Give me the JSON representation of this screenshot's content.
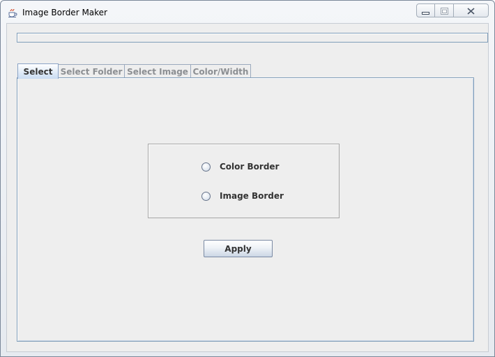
{
  "window": {
    "title": "Image Border Maker"
  },
  "tabs": [
    {
      "label": "Select",
      "selected": true
    },
    {
      "label": "Select Folder",
      "selected": false
    },
    {
      "label": "Select Image",
      "selected": false
    },
    {
      "label": "Color/Width",
      "selected": false
    }
  ],
  "border_options": [
    {
      "label": "Color Border",
      "checked": false
    },
    {
      "label": "Image Border",
      "checked": false
    }
  ],
  "apply_button": {
    "label": "Apply"
  },
  "icons": {
    "app": "java-coffee-cup-icon",
    "minimize": "minimize-icon",
    "maximize": "maximize-icon",
    "close": "close-icon"
  },
  "colors": {
    "tab_selected_top": "#ffffff",
    "tab_selected_bottom": "#c9dcf2",
    "panel_border": "#7f9db9",
    "background": "#eeeeee"
  }
}
